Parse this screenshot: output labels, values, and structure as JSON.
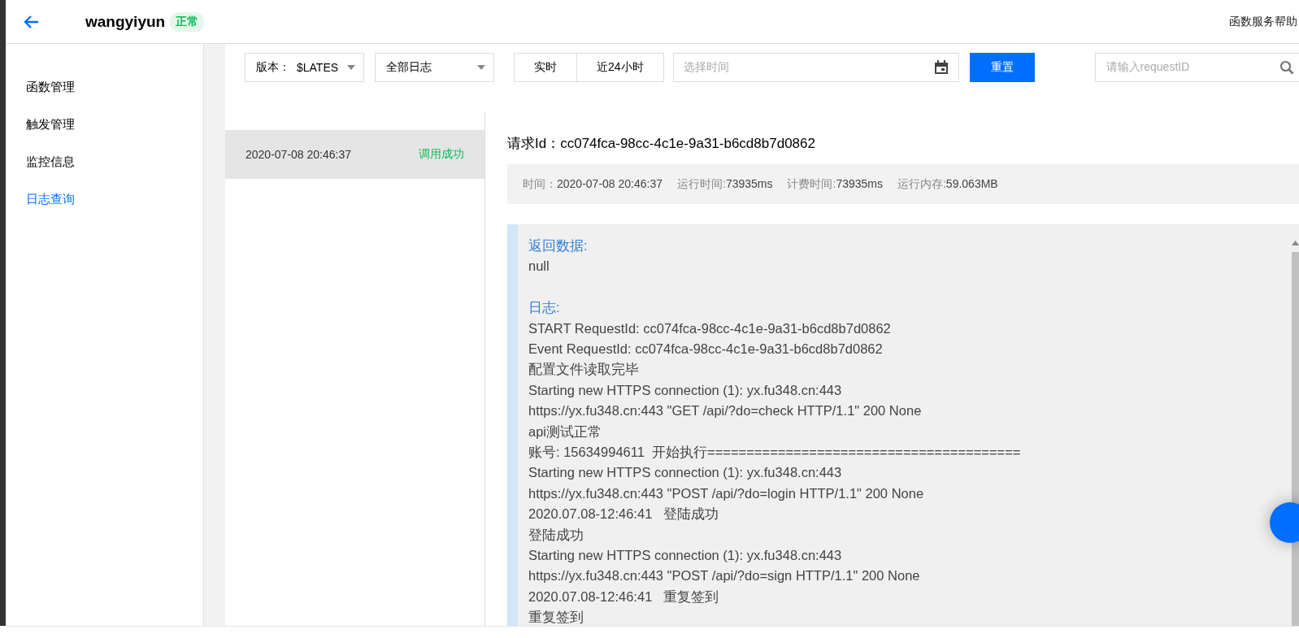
{
  "header": {
    "function_name": "wangyiyun",
    "status": "正常",
    "help_link": "函数服务帮助"
  },
  "sidebar": {
    "items": [
      {
        "label": "函数管理",
        "selected": false
      },
      {
        "label": "触发管理",
        "selected": false
      },
      {
        "label": "监控信息",
        "selected": false
      },
      {
        "label": "日志查询",
        "selected": true
      }
    ]
  },
  "filters": {
    "version_label": "版本：",
    "version_value": "$LATES",
    "log_type": "全部日志",
    "time_ranges": [
      {
        "label": "实时",
        "selected": false
      },
      {
        "label": "近24小时",
        "selected": false
      }
    ],
    "date_placeholder": "选择时间",
    "reset_button": "重置",
    "search_placeholder": "请输入requestID"
  },
  "invocations": [
    {
      "time": "2020-07-08 20:46:37",
      "status": "调用成功",
      "selected": true
    }
  ],
  "detail": {
    "request_id_label": "请求Id：",
    "request_id": "cc074fca-98cc-4c1e-9a31-b6cd8b7d0862",
    "meta": [
      {
        "label": "时间：",
        "value": "2020-07-08 20:46:37"
      },
      {
        "label": "运行时间:",
        "value": "73935ms"
      },
      {
        "label": "计费时间:",
        "value": "73935ms"
      },
      {
        "label": "运行内存:",
        "value": "59.063MB"
      }
    ],
    "return_label": "返回数据:",
    "return_value": "null",
    "log_label": "日志:",
    "log_lines": [
      "START RequestId: cc074fca-98cc-4c1e-9a31-b6cd8b7d0862",
      "Event RequestId: cc074fca-98cc-4c1e-9a31-b6cd8b7d0862",
      "配置文件读取完毕",
      "Starting new HTTPS connection (1): yx.fu348.cn:443",
      "https://yx.fu348.cn:443 \"GET /api/?do=check HTTP/1.1\" 200 None",
      "api测试正常",
      "账号: 15634994611  开始执行========================================",
      "Starting new HTTPS connection (1): yx.fu348.cn:443",
      "https://yx.fu348.cn:443 \"POST /api/?do=login HTTP/1.1\" 200 None",
      "2020.07.08-12:46:41   登陆成功",
      "登陆成功",
      "Starting new HTTPS connection (1): yx.fu348.cn:443",
      "https://yx.fu348.cn:443 \"POST /api/?do=sign HTTP/1.1\" 200 None",
      "2020.07.08-12:46:41   重复签到",
      "重复签到"
    ]
  }
}
